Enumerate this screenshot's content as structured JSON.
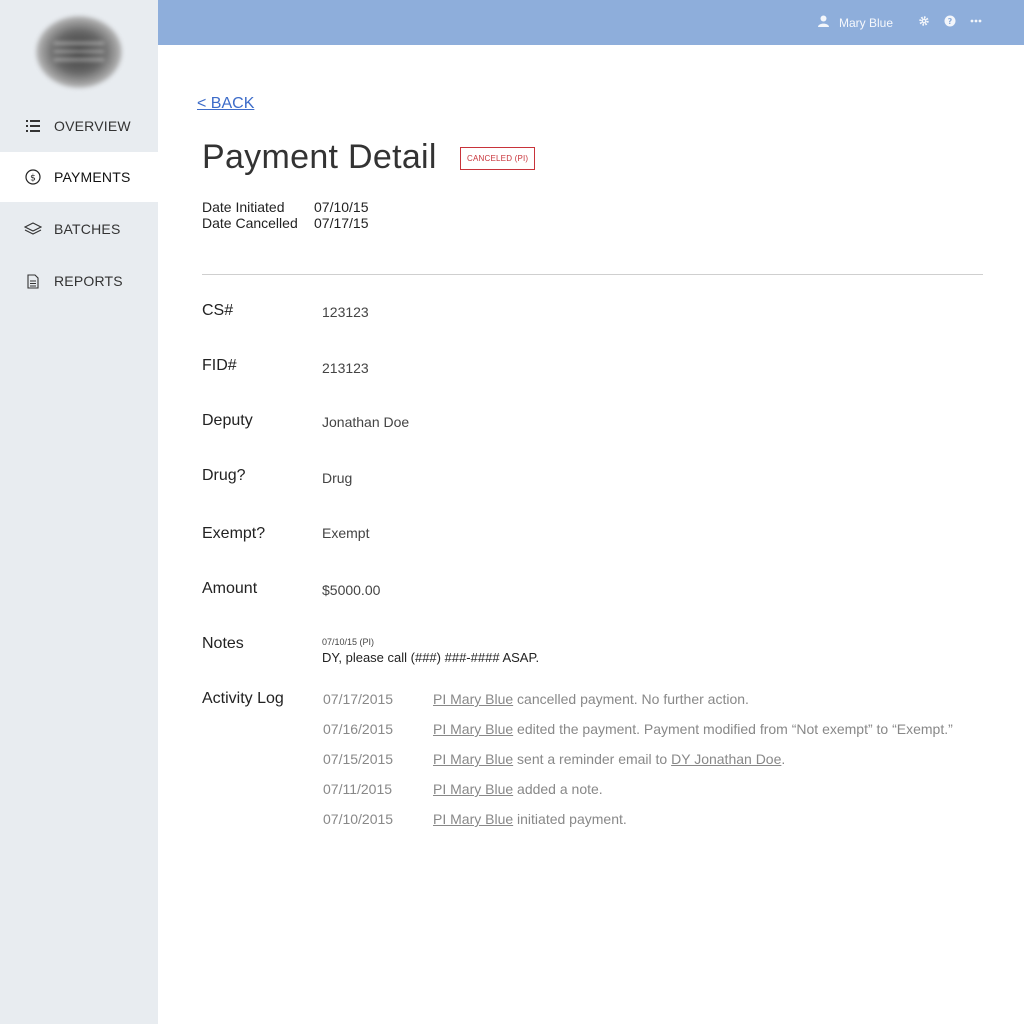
{
  "topbar": {
    "user_name": "Mary Blue",
    "icons": [
      "user-icon",
      "gear-icon",
      "help-icon",
      "more-icon"
    ],
    "color": "#8eaedb"
  },
  "sidebar": {
    "items": [
      {
        "label": "OVERVIEW",
        "icon": "list-icon",
        "active": false
      },
      {
        "label": "PAYMENTS",
        "icon": "dollar-icon",
        "active": true
      },
      {
        "label": "BATCHES",
        "icon": "layers-icon",
        "active": false
      },
      {
        "label": "REPORTS",
        "icon": "document-icon",
        "active": false
      }
    ]
  },
  "main": {
    "back_label": "< BACK",
    "title": "Payment Detail",
    "status_badge": "CANCELED (PI)",
    "status_color": "#c8333a",
    "dates": [
      {
        "label": "Date Initiated",
        "value": "07/10/15"
      },
      {
        "label": "Date Cancelled",
        "value": "07/17/15"
      }
    ],
    "fields": [
      {
        "label": "CS#",
        "value": "123123"
      },
      {
        "label": "FID#",
        "value": "213123"
      },
      {
        "label": "Deputy",
        "value": "Jonathan Doe"
      },
      {
        "label": "Drug?",
        "value": "Drug"
      },
      {
        "label": "Exempt?",
        "value": "Exempt"
      },
      {
        "label": "Amount",
        "value": "$5000.00"
      }
    ],
    "notes": {
      "label": "Notes",
      "date": "07/10/15 (PI)",
      "text": "DY, please call (###) ###-#### ASAP."
    },
    "activity_log": {
      "label": "Activity Log",
      "entries": [
        {
          "date": "07/17/2015",
          "actor": "PI Mary Blue",
          "text": " cancelled payment. No further action.",
          "target": "",
          "suffix": ""
        },
        {
          "date": "07/16/2015",
          "actor": "PI Mary Blue",
          "text": " edited the payment. Payment modified from “Not exempt” to “Exempt.”",
          "target": "",
          "suffix": ""
        },
        {
          "date": "07/15/2015",
          "actor": "PI Mary Blue",
          "text": " sent a reminder email to ",
          "target": "DY Jonathan Doe",
          "suffix": "."
        },
        {
          "date": "07/11/2015",
          "actor": "PI Mary Blue",
          "text": " added a note.",
          "target": "",
          "suffix": ""
        },
        {
          "date": "07/10/2015",
          "actor": "PI Mary Blue",
          "text": " initiated payment.",
          "target": "",
          "suffix": ""
        }
      ]
    }
  }
}
